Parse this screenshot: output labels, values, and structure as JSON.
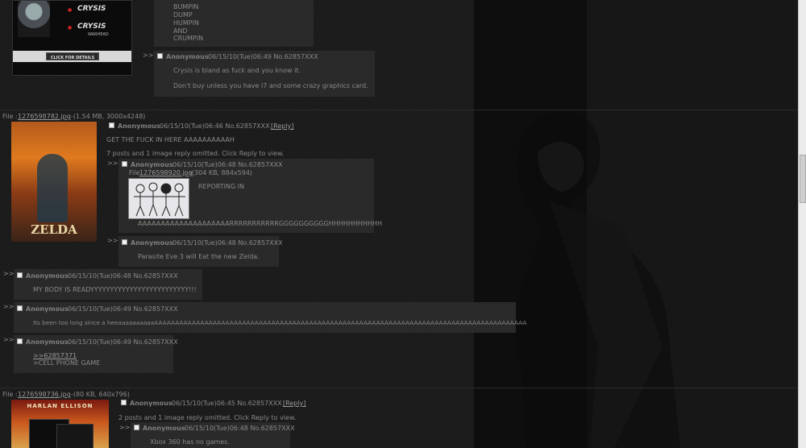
{
  "top_ad": {
    "brand1": "CRYSIS",
    "brand2": "CRYSIS",
    "brand2_sub": "WARHEAD",
    "cta": "CLICK FOR DETAILS"
  },
  "top_post_lines": [
    "BUMPIN",
    "DUMP",
    "HUMPIN",
    "AND",
    "CRUMPIN"
  ],
  "reply_crysis": {
    "arrows": ">>",
    "name": "Anonymous",
    "meta": "06/15/10(Tue)06:49 No.62857XXX",
    "line1": "Crysis is bland as fuck and you know it.",
    "line2": "Don't buy unless you have i7 and some crazy graphics card."
  },
  "thread1": {
    "file_label": "File :",
    "file_name": "1276598782.jpg",
    "file_info": "-(1.54 MB, 3000x4248)",
    "thumb_text": "ZELDA",
    "name": "Anonymous",
    "meta": "06/15/10(Tue)06:46 No.62857XXX",
    "reply_link": "[Reply]",
    "body": "GET THE FUCK IN HERE AAAAAAAAAAH",
    "omitted": "7 posts and 1 image reply omitted. Click Reply to view."
  },
  "reply_reporting": {
    "arrows": ">>",
    "name": "Anonymous",
    "meta": "06/15/10(Tue)06:48 No.62857XXX",
    "file_label": "File",
    "file_name": "1276598920.jpg",
    "file_info": "-(304 KB, 884x594)",
    "body1": "REPORTING IN",
    "body2": "AAAAAAAAAAAAAAAAAAAARRRRRRRRRRRGGGGGGGGGGHHHHHHHHHHH"
  },
  "reply_parasite": {
    "arrows": ">>",
    "name": "Anonymous",
    "meta": "06/15/10(Tue)06:48 No.62857XXX",
    "body": "Parasite Eve 3 will Eat the new Zelda."
  },
  "reply_body": {
    "arrows": ">>",
    "name": "Anonymous",
    "meta": "06/15/10(Tue)06:48 No.62857XXX",
    "body": "MY BODY IS READYYYYYYYYYYYYYYYYYYYYYYYYY!!!"
  },
  "reply_too_long": {
    "arrows": ">>",
    "name": "Anonymous",
    "meta": "06/15/10(Tue)06:49 No.62857XXX",
    "body": "Its been too long since a heeaaaaaaaaaaAAAAAAAAAAAAAAAAAAAAAAAAAAAAAAAAAAAAAAAAAAAAAAAAAAAAAAAAAAAAAAAAAAAAAAAAAAAAAAAAAAAAAAAAA"
  },
  "reply_cell": {
    "arrows": ">>",
    "name": "Anonymous",
    "meta": "06/15/10(Tue)06:49 No.62857XXX",
    "quote_link": ">>62857371",
    "body": ">CELL PHONE GAME"
  },
  "thread2": {
    "file_label": "File :",
    "file_name": "1276598736.jpg",
    "file_info": "-(80 KB, 640x796)",
    "thumb_text": "HARLAN ELLISON",
    "name": "Anonymous",
    "meta": "06/15/10(Tue)06:45 No.62857XXX",
    "reply_link": "[Reply]",
    "omitted": "2 posts and 1 image reply omitted. Click Reply to view."
  },
  "reply_xbox": {
    "arrows": ">>",
    "name": "Anonymous",
    "meta": "06/15/10(Tue)06:48 No.62857XXX",
    "body": "Xbox 360 has no games."
  }
}
